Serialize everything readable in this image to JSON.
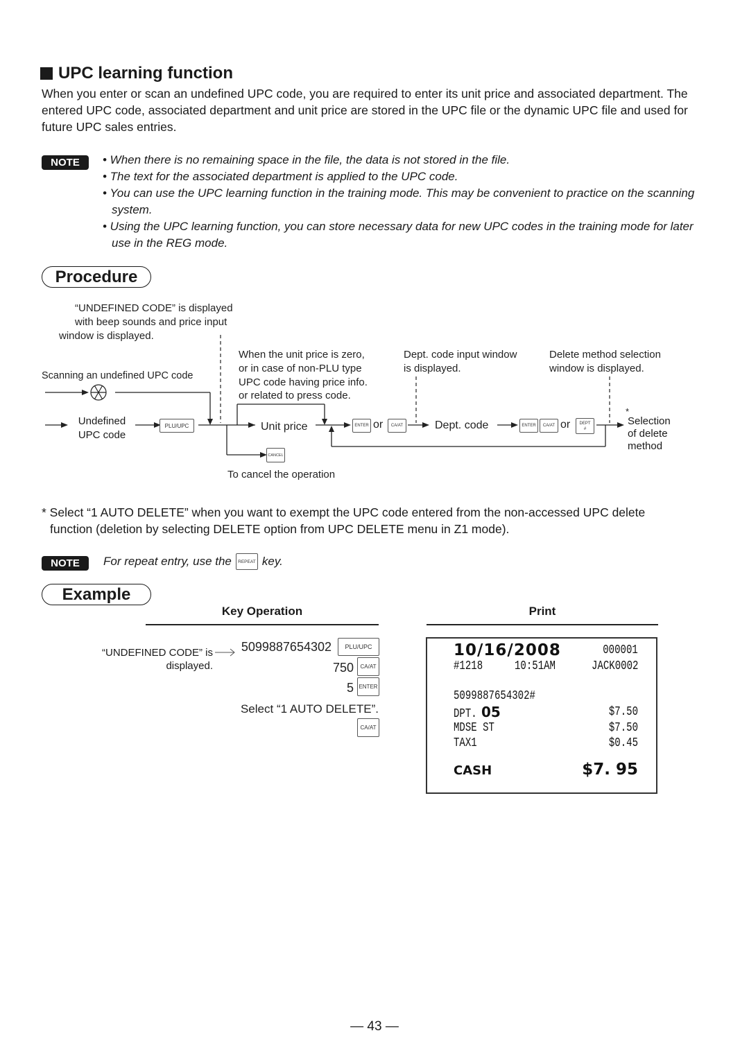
{
  "section": {
    "title": "UPC learning function",
    "intro": "When you enter or scan an undefined UPC code, you are required to enter its unit price and associated department. The entered UPC code, associated department and unit price are stored in the UPC file or the dynamic UPC file and used for future UPC sales entries."
  },
  "notes": {
    "badge": "NOTE",
    "items": [
      "• When there is no remaining space in the file, the data is not stored in the file.",
      "• The text for the associated department is applied to the UPC code.",
      "• You can use the UPC learning function in the training mode. This may be convenient to practice on the scanning system.",
      "• Using the UPC learning function, you can store necessary data for new UPC codes in the training mode for later use in the REG mode."
    ]
  },
  "procedure": {
    "title": "Procedure",
    "undefined_note": [
      "“UNDEFINED CODE” is displayed",
      "with beep sounds and price input",
      "window is displayed."
    ],
    "scanning_label": "Scanning an undefined UPC code",
    "undefined_label": [
      "Undefined",
      "UPC code"
    ],
    "zero_price_note": [
      "When the unit price is zero,",
      "or in case of non-PLU type",
      "UPC code having price info.",
      "or related to press code."
    ],
    "dept_window_note": [
      "Dept. code input window",
      "is displayed."
    ],
    "delete_window_note": [
      "Delete method selection",
      "window is displayed."
    ],
    "unit_price_label": "Unit price",
    "dept_code_label": "Dept. code",
    "or_label": "or",
    "asterisk": "*",
    "selection_label": [
      "Selection",
      "of delete",
      "method"
    ],
    "cancel_label": "To cancel the operation",
    "keys": {
      "plu_upc": "PLU/UPC",
      "enter": "ENTER",
      "ca_at": "CA/AT",
      "dept": "DEPT",
      "dept_sub": "#",
      "cancel": "CANCEL",
      "repeat": "REPEAT"
    }
  },
  "footnote": {
    "text_line1": "* Select “1 AUTO DELETE” when you want to exempt the UPC code entered from the non-accessed UPC delete",
    "text_line2": "function (deletion by selecting DELETE option from UPC DELETE menu in Z1 mode).",
    "note_badge": "NOTE",
    "note_pre": "For repeat entry, use the",
    "note_post": "key."
  },
  "example": {
    "title": "Example",
    "key_operation_header": "Key Operation",
    "print_header": "Print",
    "undefined_note": [
      "“UNDEFINED CODE” is",
      "displayed."
    ],
    "steps": [
      {
        "value": "5099887654302",
        "key": "PLU/UPC"
      },
      {
        "value": "750",
        "key": "CA/AT"
      },
      {
        "value": "5",
        "key": "ENTER"
      },
      {
        "value": "Select “1 AUTO DELETE”.",
        "key": ""
      },
      {
        "value": "",
        "key": "CA/AT"
      }
    ],
    "receipt": {
      "date": "10/16/2008",
      "consecutive_no": "000001",
      "register_no": "#1218",
      "time": "10:51AM",
      "clerk": "JACK0002",
      "upc": "5099887654302#",
      "lines": [
        {
          "label_prefix": "DPT.",
          "label_big": "05",
          "amount": "$7.50"
        },
        {
          "label_prefix": "MDSE ST",
          "label_big": "",
          "amount": "$7.50"
        },
        {
          "label_prefix": "TAX1",
          "label_big": "",
          "amount": "$0.45"
        }
      ],
      "total_label": "CASH",
      "total_amount": "$7. 95"
    }
  },
  "page_number": "— 43 —"
}
